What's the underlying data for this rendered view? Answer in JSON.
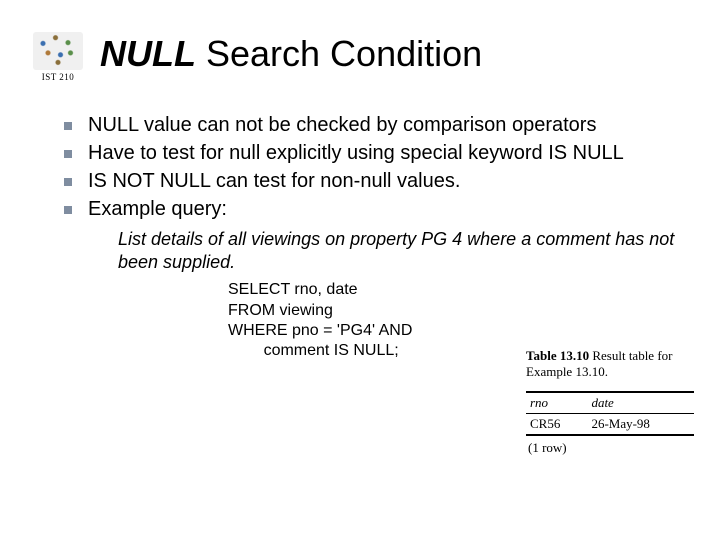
{
  "logo": {
    "label": "IST 210"
  },
  "title": {
    "bold_italic": "NULL",
    "rest": " Search Condition"
  },
  "bullets": [
    "NULL value can not be checked by comparison operators",
    "Have to test for null explicitly using special keyword IS NULL",
    "IS NOT NULL can test for non-null values.",
    "Example query:"
  ],
  "example_desc": "List details of all viewings on property PG 4 where a comment has not been supplied.",
  "sql": "SELECT rno, date\nFROM viewing\nWHERE pno = 'PG4' AND\n        comment IS NULL;",
  "result": {
    "caption_label": "Table 13.10",
    "caption_rest": "   Result table for Example 13.10.",
    "headers": [
      "rno",
      "date"
    ],
    "rows": [
      [
        "CR56",
        "26-May-98"
      ]
    ],
    "footer": "(1 row)"
  }
}
